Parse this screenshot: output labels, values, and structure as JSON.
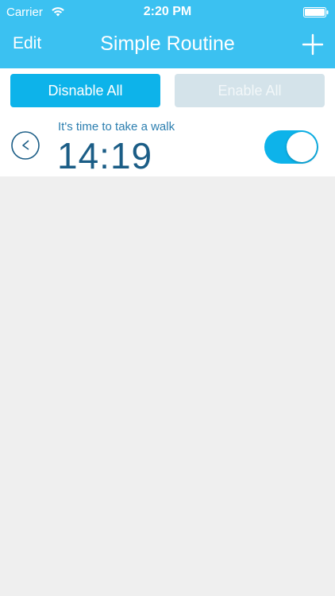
{
  "status_bar": {
    "carrier": "Carrier",
    "time": "2:20 PM"
  },
  "nav": {
    "left_label": "Edit",
    "title": "Simple Routine",
    "add_icon": "plus-icon"
  },
  "actions": {
    "disable_all_label": "Disnable All",
    "enable_all_label": "Enable All"
  },
  "routines": [
    {
      "message": "It's time to take a walk",
      "time": "14:19",
      "enabled": true,
      "icon": "clock-icon"
    }
  ],
  "colors": {
    "header": "#3bc1f1",
    "primary_button": "#0db3ea",
    "disabled_button": "#d4e3ea",
    "time_text": "#1b5d86",
    "message_text": "#2d7fb0",
    "background": "#efefef"
  }
}
